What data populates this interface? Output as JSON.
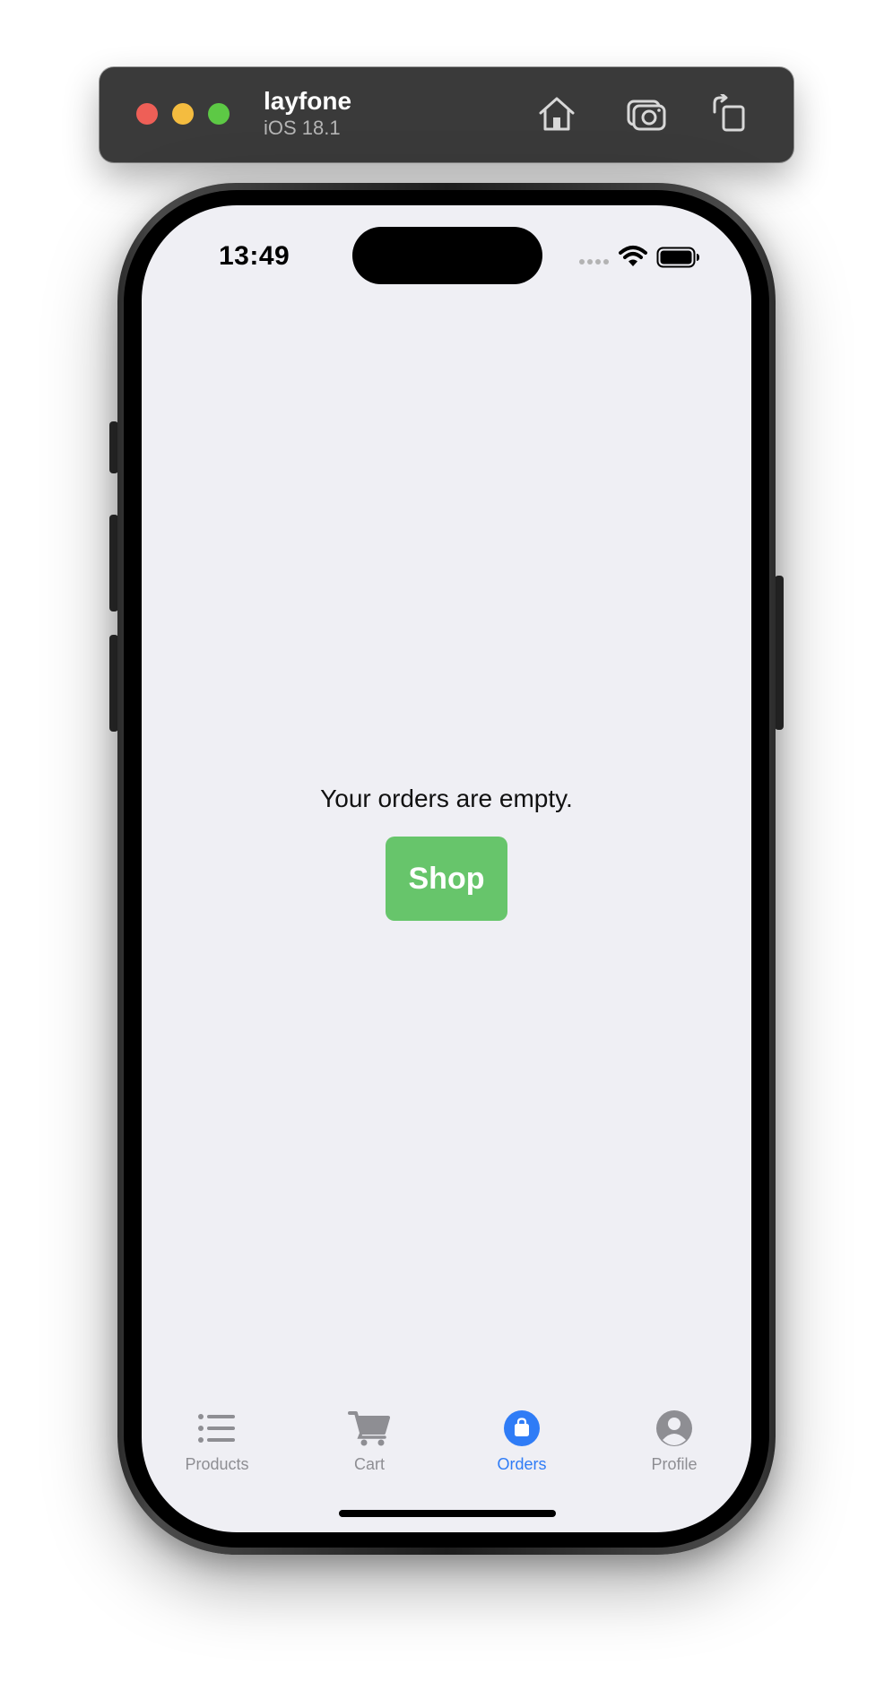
{
  "toolbar": {
    "device_name": "layfone",
    "os_version": "iOS 18.1",
    "buttons": [
      {
        "icon": "home-icon"
      },
      {
        "icon": "screenshot-icon"
      },
      {
        "icon": "rotate-icon"
      }
    ]
  },
  "status_bar": {
    "time": "13:49"
  },
  "main": {
    "empty_message": "Your orders are empty.",
    "shop_button_label": "Shop",
    "shop_button_color": "#67c56b"
  },
  "tab_bar": {
    "active_color": "#2f7cf6",
    "inactive_color": "#8e8e93",
    "tabs": [
      {
        "label": "Products",
        "icon": "list-icon",
        "active": false
      },
      {
        "label": "Cart",
        "icon": "cart-icon",
        "active": false
      },
      {
        "label": "Orders",
        "icon": "bag-icon",
        "active": true
      },
      {
        "label": "Profile",
        "icon": "person-icon",
        "active": false
      }
    ]
  }
}
